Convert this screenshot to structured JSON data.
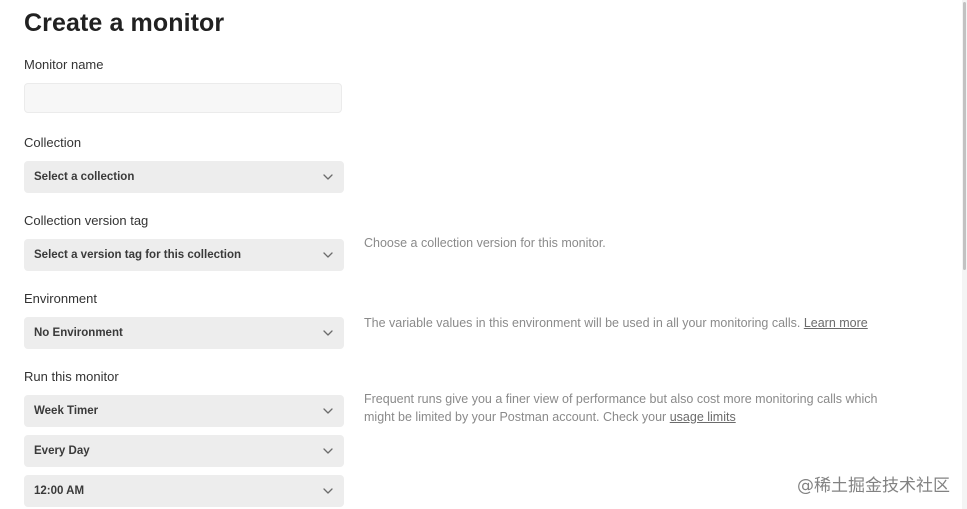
{
  "page": {
    "title": "Create a monitor"
  },
  "monitor_name": {
    "label": "Monitor name",
    "value": "",
    "placeholder": ""
  },
  "collection": {
    "label": "Collection",
    "selected": "Select a collection"
  },
  "version_tag": {
    "label": "Collection version tag",
    "selected": "Select a version tag for this collection",
    "help": "Choose a collection version for this monitor."
  },
  "environment": {
    "label": "Environment",
    "selected": "No Environment",
    "help": "The variable values in this environment will be used in all your monitoring calls.",
    "help_link": "Learn more"
  },
  "schedule": {
    "label": "Run this monitor",
    "timer": "Week Timer",
    "day": "Every Day",
    "time": "12:00 AM",
    "help_line1": "Frequent runs give you a finer view of performance but also cost more monitoring calls which",
    "help_line2": "might be limited by your Postman account. Check your",
    "help_link": "usage limits"
  },
  "watermark": {
    "text": "@稀土掘金技术社区"
  },
  "icons": {
    "dropdown": "chevron-down-icon"
  },
  "colors": {
    "select_bg": "#ededed",
    "input_bg": "#f7f7f7",
    "help_text": "#8a8a8a"
  }
}
